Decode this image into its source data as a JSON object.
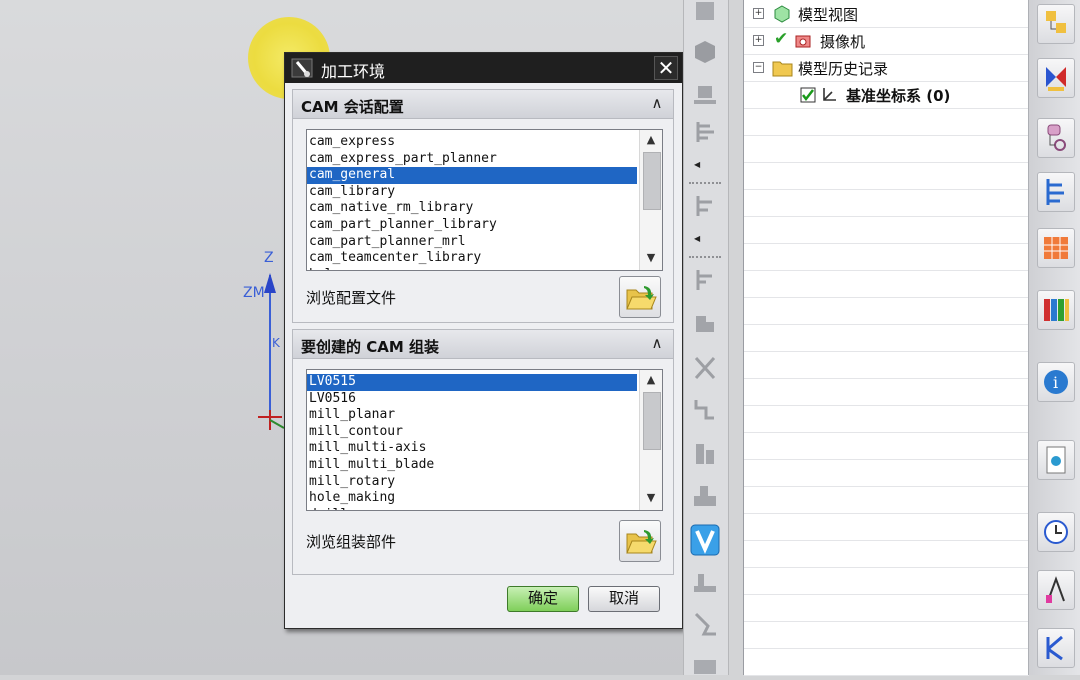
{
  "dialog": {
    "title": "加工环境",
    "close_glyph": "✕",
    "session_group": {
      "header": "CAM 会话配置",
      "collapse_glyph": "∧",
      "items": [
        "cam_express",
        "cam_express_part_planner",
        "cam_general",
        "cam_library",
        "cam_native_rm_library",
        "cam_part_planner_library",
        "cam_part_planner_mrl",
        "cam_teamcenter_library",
        "hole"
      ],
      "selected_index": 2,
      "browse_label": "浏览配置文件"
    },
    "setup_group": {
      "header": "要创建的 CAM 组装",
      "collapse_glyph": "∧",
      "items": [
        "LV0515",
        "LV0516",
        "mill_planar",
        "mill_contour",
        "mill_multi-axis",
        "mill_multi_blade",
        "mill_rotary",
        "hole_making",
        "drill"
      ],
      "selected_index": 0,
      "browse_label": "浏览组装部件"
    },
    "ok_label": "确定",
    "cancel_label": "取消"
  },
  "viewport": {
    "axis_z": "Z",
    "axis_zm": "ZM",
    "axis_k": "K"
  },
  "tree": {
    "nodes": [
      {
        "label": "模型视图",
        "expander": "+"
      },
      {
        "label": "摄像机",
        "expander": "+"
      },
      {
        "label": "模型历史记录",
        "expander": "−"
      },
      {
        "label": "基准坐标系 (0)",
        "expander": ""
      }
    ]
  },
  "colors": {
    "selection": "#1f66c4",
    "ok_button": "#7fcf5a",
    "title_bar": "#1f1f1f",
    "cursor_halo": "#ecdc40"
  }
}
